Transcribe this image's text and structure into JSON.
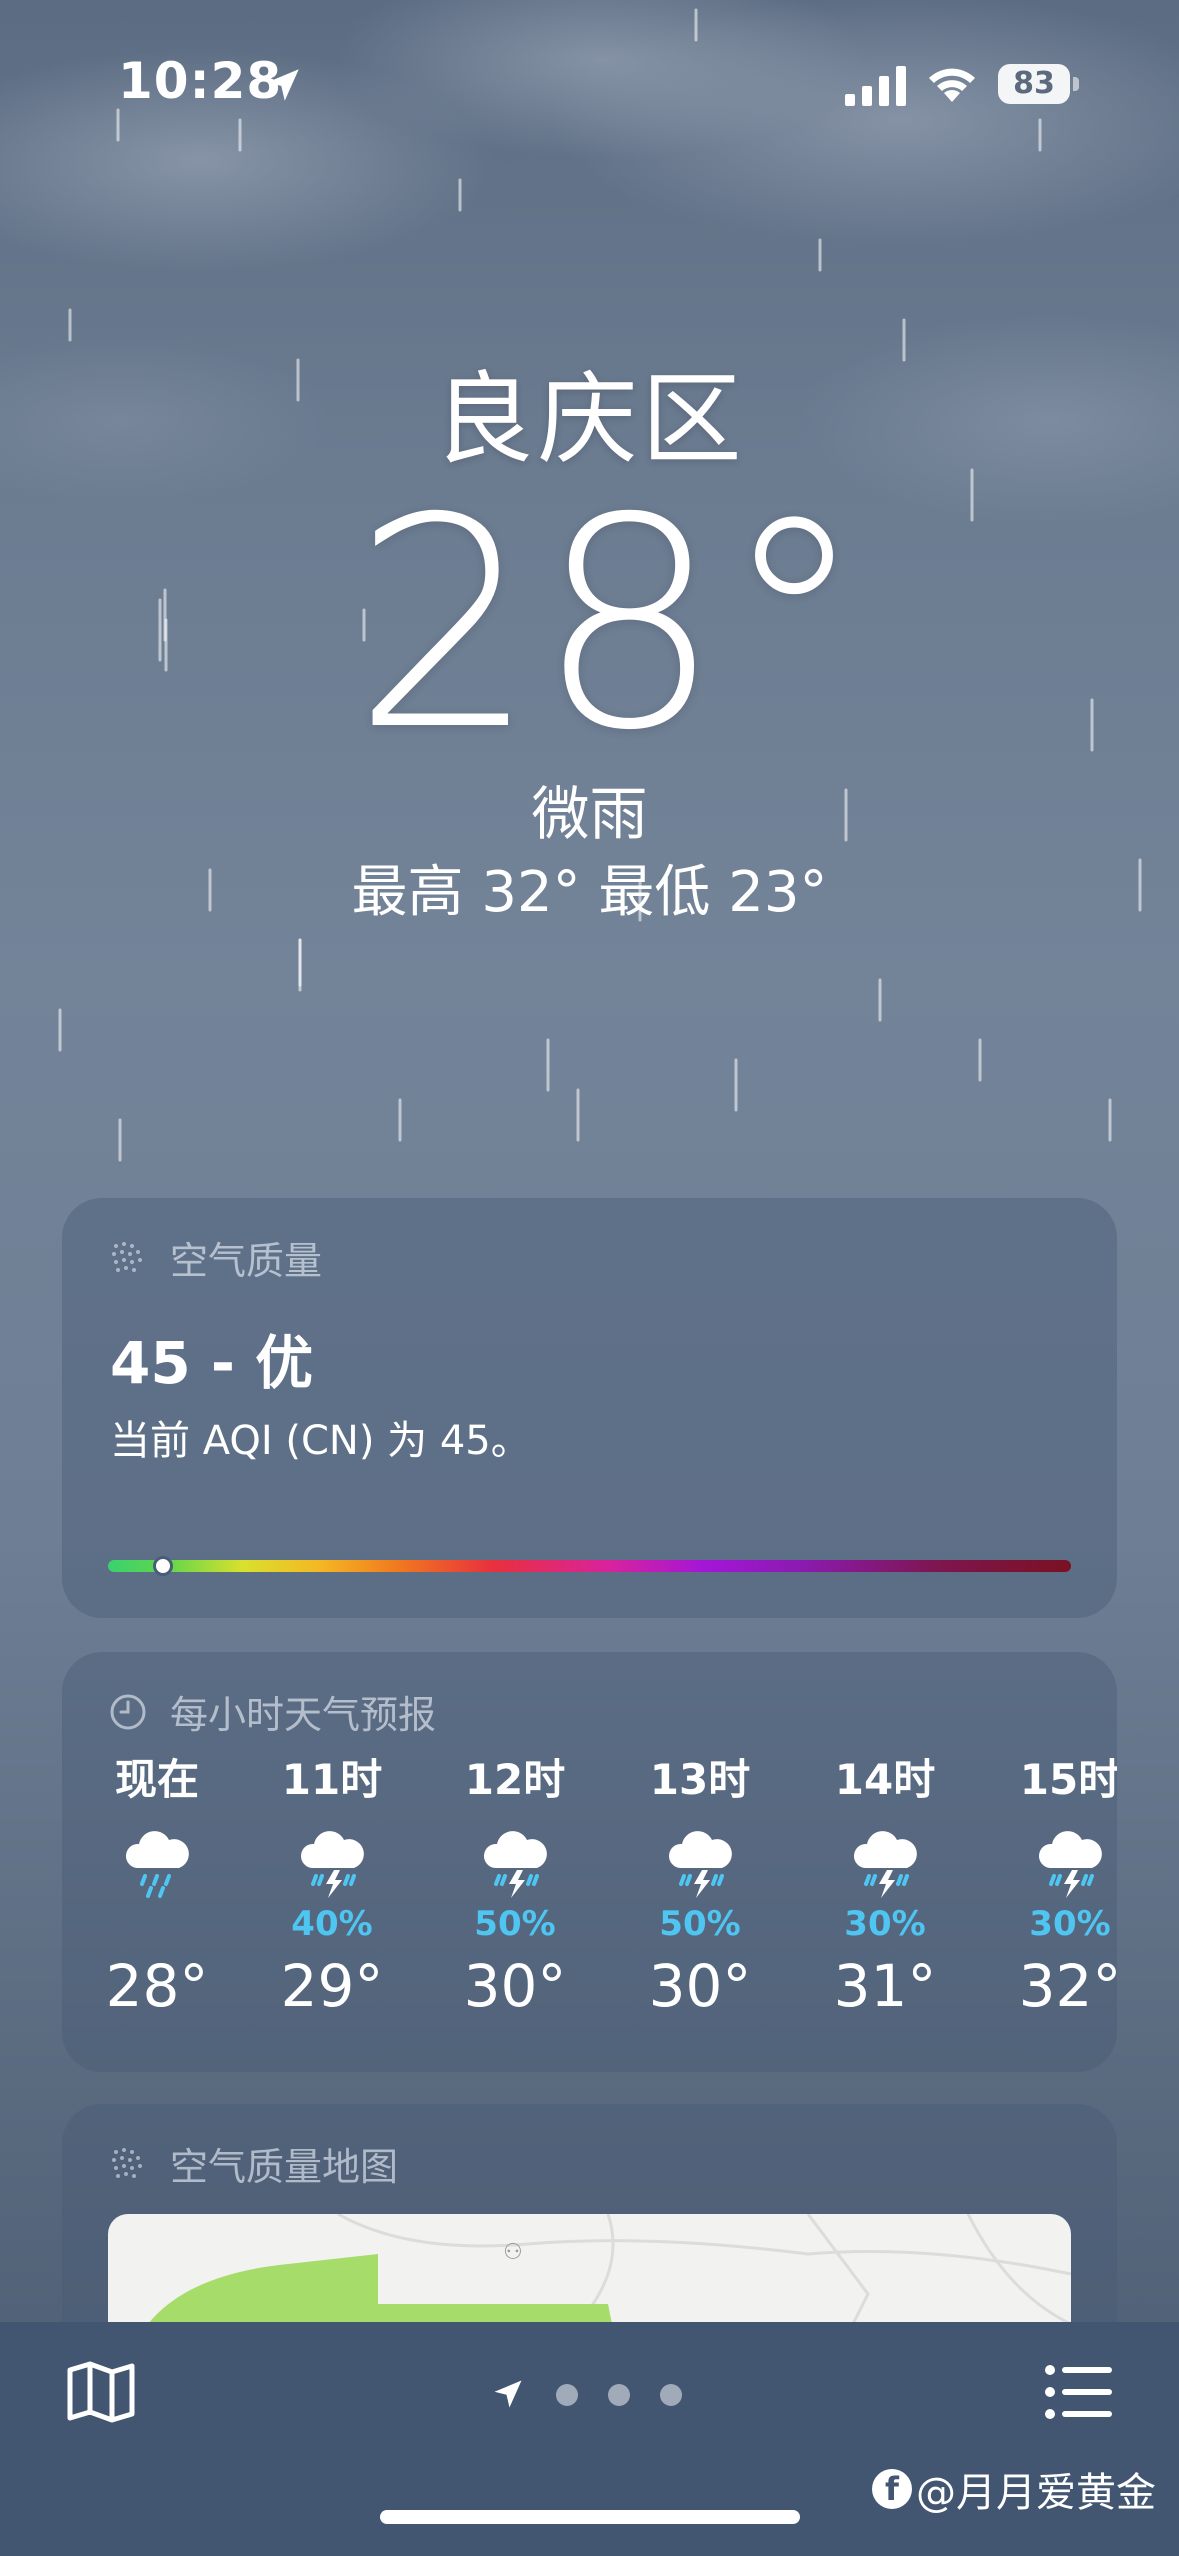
{
  "status_bar": {
    "time": "10:28",
    "battery": "83"
  },
  "current": {
    "city": "良庆区",
    "temperature": "28°",
    "condition": "微雨",
    "high_low": "最高 32°  最低 23°"
  },
  "air_quality": {
    "title": "空气质量",
    "value": "45 - 优",
    "description": "当前 AQI (CN) 为 45。",
    "scale_position": 0.057
  },
  "hourly": {
    "title": "每小时天气预报",
    "items": [
      {
        "label": "现在",
        "icon": "rain-cloud-icon",
        "precip": "",
        "temp": "28°"
      },
      {
        "label": "11时",
        "icon": "thunderstorm-icon",
        "precip": "40%",
        "temp": "29°"
      },
      {
        "label": "12时",
        "icon": "thunderstorm-icon",
        "precip": "50%",
        "temp": "30°"
      },
      {
        "label": "13时",
        "icon": "thunderstorm-icon",
        "precip": "50%",
        "temp": "30°"
      },
      {
        "label": "14时",
        "icon": "thunderstorm-icon",
        "precip": "30%",
        "temp": "31°"
      },
      {
        "label": "15时",
        "icon": "thunderstorm-icon",
        "precip": "30%",
        "temp": "32°"
      }
    ]
  },
  "aqi_map": {
    "title": "空气质量地图"
  },
  "toolbar": {
    "map_icon": "map-icon",
    "list_icon": "list-icon",
    "pages": 3
  },
  "watermark": {
    "text": "@月月爱黄金"
  },
  "colors": {
    "precip": "#4fc6f2",
    "card_bg": "rgba(72,90,116,0.42)",
    "bottom_bar": "#425571"
  }
}
